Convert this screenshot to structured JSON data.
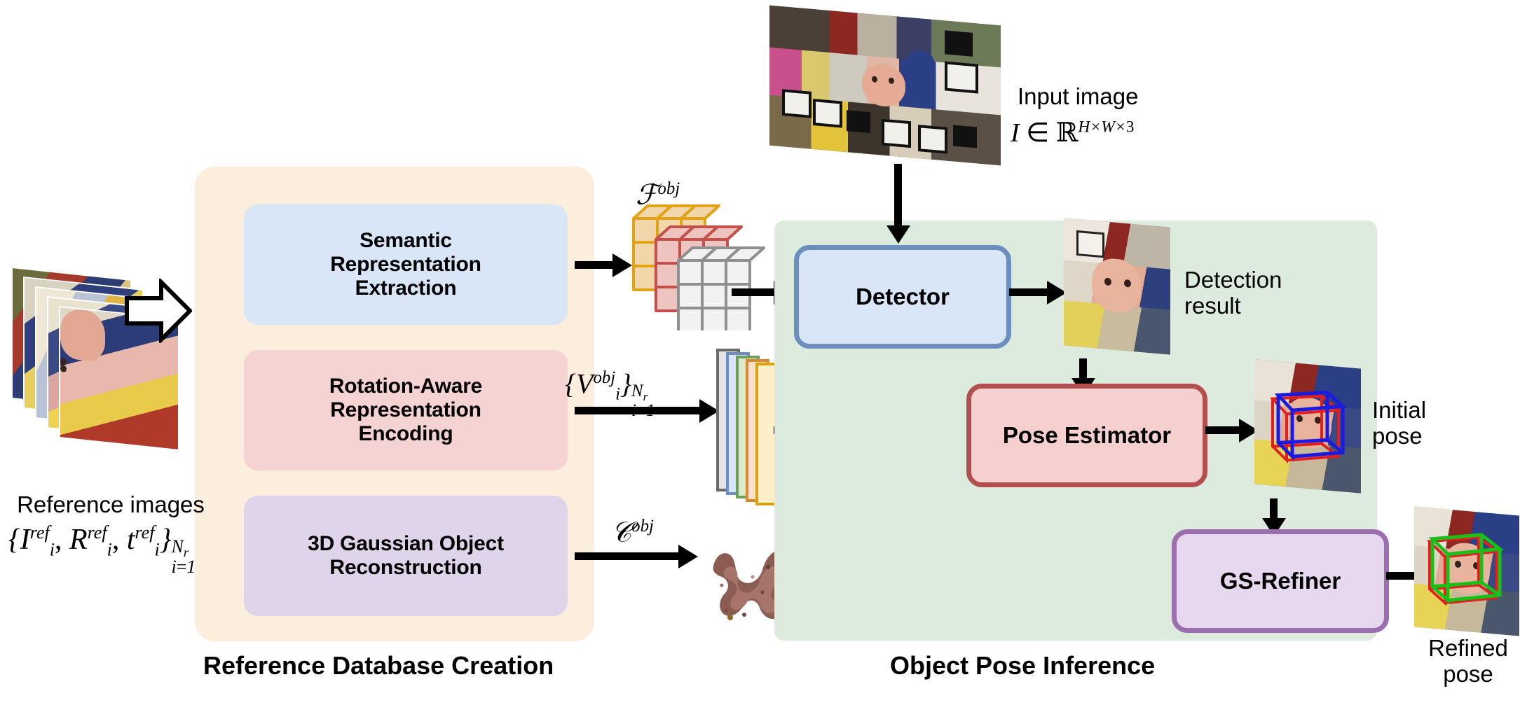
{
  "figure": {
    "type": "pipeline-diagram",
    "sections": [
      {
        "id": "reference-database-creation",
        "caption": "Reference Database Creation"
      },
      {
        "id": "object-pose-inference",
        "caption": "Object Pose Inference"
      }
    ]
  },
  "left": {
    "caption": "Reference Database Creation",
    "input": {
      "label_line1": "Reference images",
      "math": {
        "open": "{",
        "I": "I",
        "I_sup": "ref",
        "I_sub": "i",
        "comma1": ",",
        "R": "R",
        "R_sup": "ref",
        "R_sub": "i",
        "comma2": ",",
        "t": "t",
        "t_sup": "ref",
        "t_sub": "i",
        "close": "}",
        "limit_top": "N_r",
        "limit_bottom": "i=1"
      },
      "plain": "{I_i^ref, R_i^ref, t_i^ref}_{i=1}^{N_r}"
    },
    "stages": [
      {
        "id": "semantic",
        "label": "Semantic\nRepresentation\nExtraction",
        "fill": "#d9e6f7"
      },
      {
        "id": "rotation",
        "label": "Rotation-Aware\nRepresentation\nEncoding",
        "fill": "#f6d3d3"
      },
      {
        "id": "gaussian",
        "label": "3D Gaussian Object\nReconstruction",
        "fill": "#e0d4ea"
      }
    ],
    "outputs": [
      {
        "id": "feature-cube",
        "symbol": "F",
        "sup": "obj",
        "plain": "F^obj"
      },
      {
        "id": "view-vectors",
        "symbol": "V",
        "sup": "obj",
        "sub": "i",
        "limit_top": "N_r",
        "limit_bottom": "i=1",
        "plain": "{V_i^obj}_{i=1}^{N_r}"
      },
      {
        "id": "gaussian-cloud",
        "symbol": "G",
        "sup": "obj",
        "plain": "G^obj"
      }
    ]
  },
  "right": {
    "caption": "Object Pose Inference",
    "input": {
      "label": "Input image",
      "math_var": "I",
      "math_in": "∈",
      "math_set": "ℝ",
      "math_sup": "H×W×3",
      "plain": "I ∈ ℝ^{H×W×3}"
    },
    "modules": [
      {
        "id": "detector",
        "label": "Detector",
        "fill": "#d9e6f7",
        "border": "#6d8fc0"
      },
      {
        "id": "pose-estimator",
        "label": "Pose Estimator",
        "fill": "#f6cfcf",
        "border": "#b2504f"
      },
      {
        "id": "gs-refiner",
        "label": "GS-Refiner",
        "fill": "#e7d7ef",
        "border": "#9a6fad"
      }
    ],
    "results": [
      {
        "id": "detection-result",
        "label": "Detection\n  result"
      },
      {
        "id": "initial-pose",
        "label": "Initial\n pose",
        "box_colors": [
          "#1b1bdf",
          "#e02020"
        ]
      },
      {
        "id": "refined-pose",
        "label": "Refined\n pose",
        "box_colors": [
          "#18c018",
          "#e02020"
        ]
      }
    ]
  },
  "colors": {
    "left_panel": "#fceedd",
    "right_panel": "#dcebdd",
    "blue_fill": "#d9e6f7",
    "blue_border": "#6d8fc0",
    "red_fill": "#f6cfcf",
    "red_border": "#b2504f",
    "purple_fill": "#e7d7ef",
    "purple_border": "#9a6fad",
    "cube_orange": "#e8b04b",
    "cube_red": "#c15a55",
    "cube_gray": "#9a9a9a",
    "arrow": "#000000"
  },
  "vector_strips": [
    {
      "border": "#6a6a6a",
      "fill": "#e6e6e6"
    },
    {
      "border": "#6d8fc0",
      "fill": "#d9e6f7"
    },
    {
      "border": "#6aa05c",
      "fill": "#dcebcf"
    },
    {
      "border": "#d98a2b",
      "fill": "#fbe0cf"
    },
    {
      "border": "#d9a213",
      "fill": "#fdf0c8"
    }
  ]
}
